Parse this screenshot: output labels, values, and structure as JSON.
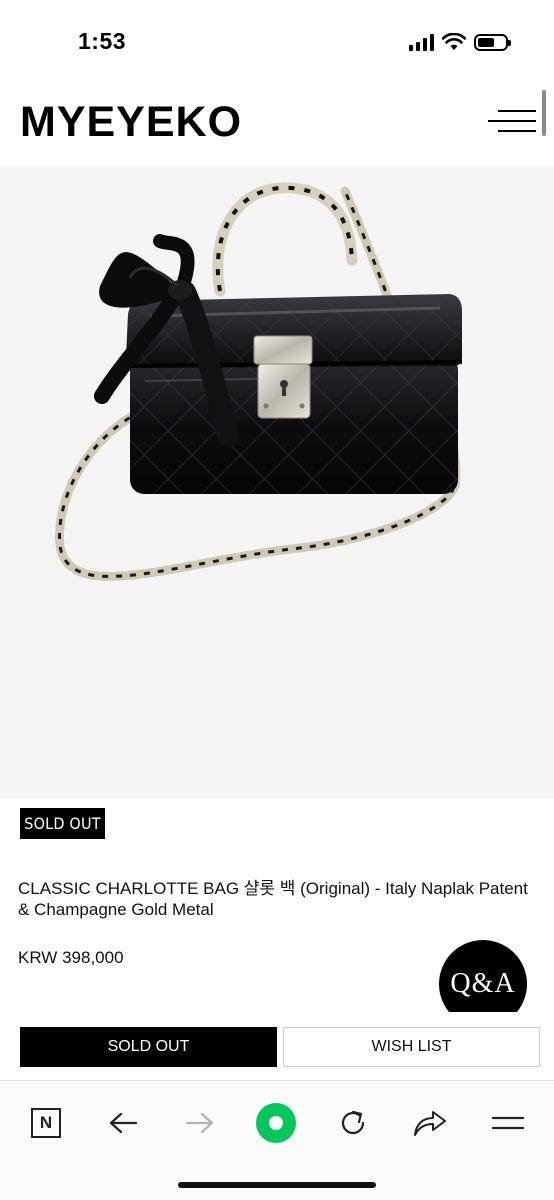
{
  "status_bar": {
    "time": "1:53",
    "battery_level": 0.6
  },
  "header": {
    "logo": "MYEYEKO",
    "menu_icon": "hamburger-menu-icon"
  },
  "product": {
    "image_alt": "black quilted patent vanity bag with chain strap and ribbon",
    "badge": "SOLD OUT",
    "title": "CLASSIC CHARLOTTE BAG 샬롯 백 (Original) - Italy Naplak Patent & Champagne Gold Metal",
    "price": "KRW 398,000"
  },
  "floating": {
    "qa_label": "Q&A"
  },
  "actions": {
    "sold_out_label": "SOLD OUT",
    "wish_list_label": "WISH LIST"
  },
  "toolbar": {
    "items": [
      {
        "name": "naver-n-icon",
        "label": "N"
      },
      {
        "name": "back-arrow-icon"
      },
      {
        "name": "forward-arrow-icon",
        "disabled": true
      },
      {
        "name": "green-home-icon",
        "color": "#03c75a"
      },
      {
        "name": "refresh-icon"
      },
      {
        "name": "share-icon"
      },
      {
        "name": "menu-icon"
      }
    ]
  }
}
